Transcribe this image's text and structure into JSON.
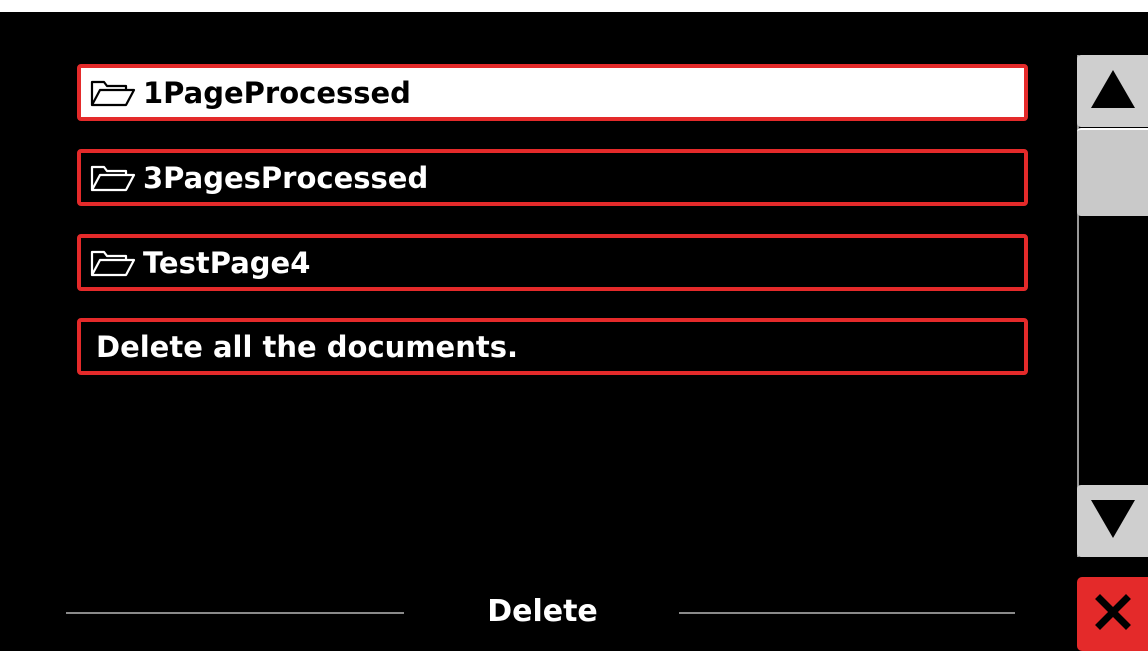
{
  "list": {
    "items": [
      {
        "label": "1PageProcessed",
        "icon": "folder-open-icon",
        "selected": true
      },
      {
        "label": "3PagesProcessed",
        "icon": "folder-open-icon",
        "selected": false
      },
      {
        "label": "TestPage4",
        "icon": "folder-open-icon",
        "selected": false
      },
      {
        "label": "Delete all the documents.",
        "icon": null,
        "selected": false
      }
    ]
  },
  "footer": {
    "title": "Delete"
  },
  "scrollbar": {
    "up_icon": "triangle-up-icon",
    "down_icon": "triangle-down-icon"
  },
  "close": {
    "icon": "close-x-icon"
  },
  "colors": {
    "accent_border": "#e42a2a",
    "selected_background": "#ffffff",
    "background": "#000000",
    "text": "#ffffff"
  }
}
